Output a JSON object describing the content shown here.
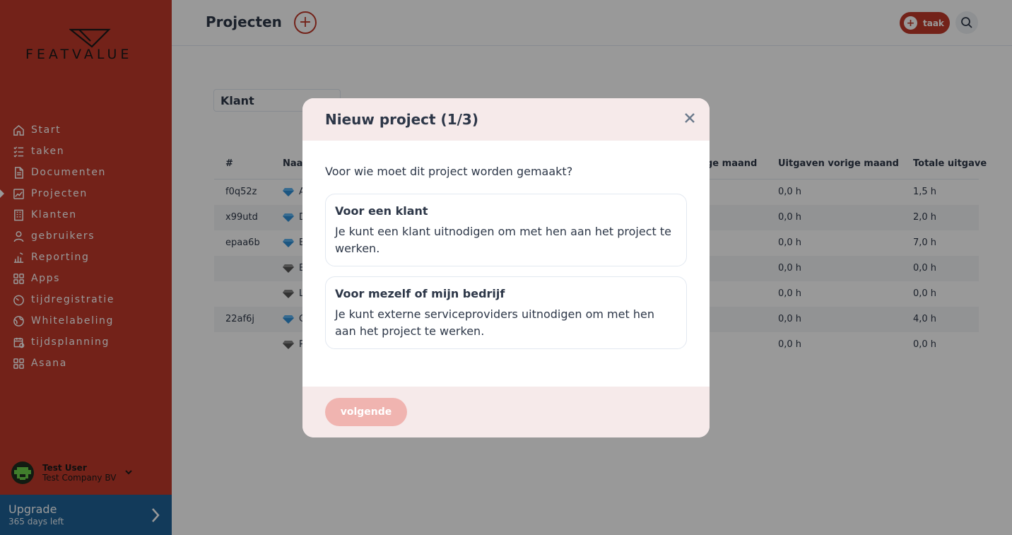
{
  "brand": {
    "logo_text": "FEATVALUE"
  },
  "sidebar": {
    "items": [
      {
        "label": "Start",
        "icon": "home-icon"
      },
      {
        "label": "taken",
        "icon": "task-list-icon"
      },
      {
        "label": "Documenten",
        "icon": "document-icon"
      },
      {
        "label": "Projecten",
        "icon": "project-icon",
        "active": true
      },
      {
        "label": "Klanten",
        "icon": "building-icon"
      },
      {
        "label": "gebruikers",
        "icon": "user-icon"
      },
      {
        "label": "Reporting",
        "icon": "bar-chart-icon"
      },
      {
        "label": "Apps",
        "icon": "apps-grid-icon"
      },
      {
        "label": "tijdregistratie",
        "icon": "timer-icon"
      },
      {
        "label": "Whitelabeling",
        "icon": "globe-icon"
      },
      {
        "label": "tijdsplanning",
        "icon": "calendar-icon"
      },
      {
        "label": "Asana",
        "icon": "apps-grid-icon"
      }
    ],
    "user": {
      "name": "Test User",
      "company": "Test Company BV"
    },
    "upgrade": {
      "title": "Upgrade",
      "subtitle": "365 days left"
    }
  },
  "header": {
    "title": "Projecten",
    "task_label": "taak"
  },
  "filter": {
    "label": "Klant"
  },
  "table": {
    "columns": [
      {
        "label": "#"
      },
      {
        "label": "Naa"
      },
      {
        "label": "ge maand"
      },
      {
        "label": "Uitgaven vorige maand"
      },
      {
        "label": "Totale uitgave"
      }
    ],
    "rows": [
      {
        "id": "f0q52z",
        "name": "A",
        "gem": "blue",
        "prev": "0,0 h",
        "total": "1,5 h"
      },
      {
        "id": "x99utd",
        "name": "D",
        "gem": "blue",
        "prev": "0,0 h",
        "total": "2,0 h"
      },
      {
        "id": "epaa6b",
        "name": "B",
        "gem": "blue",
        "prev": "0,0 h",
        "total": "7,0 h"
      },
      {
        "id": "",
        "name": "B",
        "gem": "gray",
        "prev": "0,0 h",
        "total": "0,0 h"
      },
      {
        "id": "",
        "name": "L",
        "gem": "gray",
        "prev": "0,0 h",
        "total": "0,0 h"
      },
      {
        "id": "22af6j",
        "name": "C",
        "gem": "blue",
        "prev": "0,0 h",
        "total": "4,0 h"
      },
      {
        "id": "",
        "name": "P",
        "gem": "gray",
        "prev": "0,0 h",
        "total": "0,0 h"
      }
    ]
  },
  "modal": {
    "title": "Nieuw project (1/3)",
    "question": "Voor wie moet dit project worden gemaakt?",
    "options": [
      {
        "title": "Voor een klant",
        "description": "Je kunt een klant uitnodigen om met hen aan het project te werken."
      },
      {
        "title": "Voor mezelf of mijn bedrijf",
        "description": "Je kunt externe serviceproviders uitnodigen om met hen aan het project te werken."
      }
    ],
    "next_label": "volgende"
  },
  "colors": {
    "brand_red": "#c0392b",
    "upgrade_blue": "#1e6296",
    "modal_tint": "#f6eaea",
    "gem_blue": "#2f8fd8",
    "gem_gray": "#555555"
  }
}
